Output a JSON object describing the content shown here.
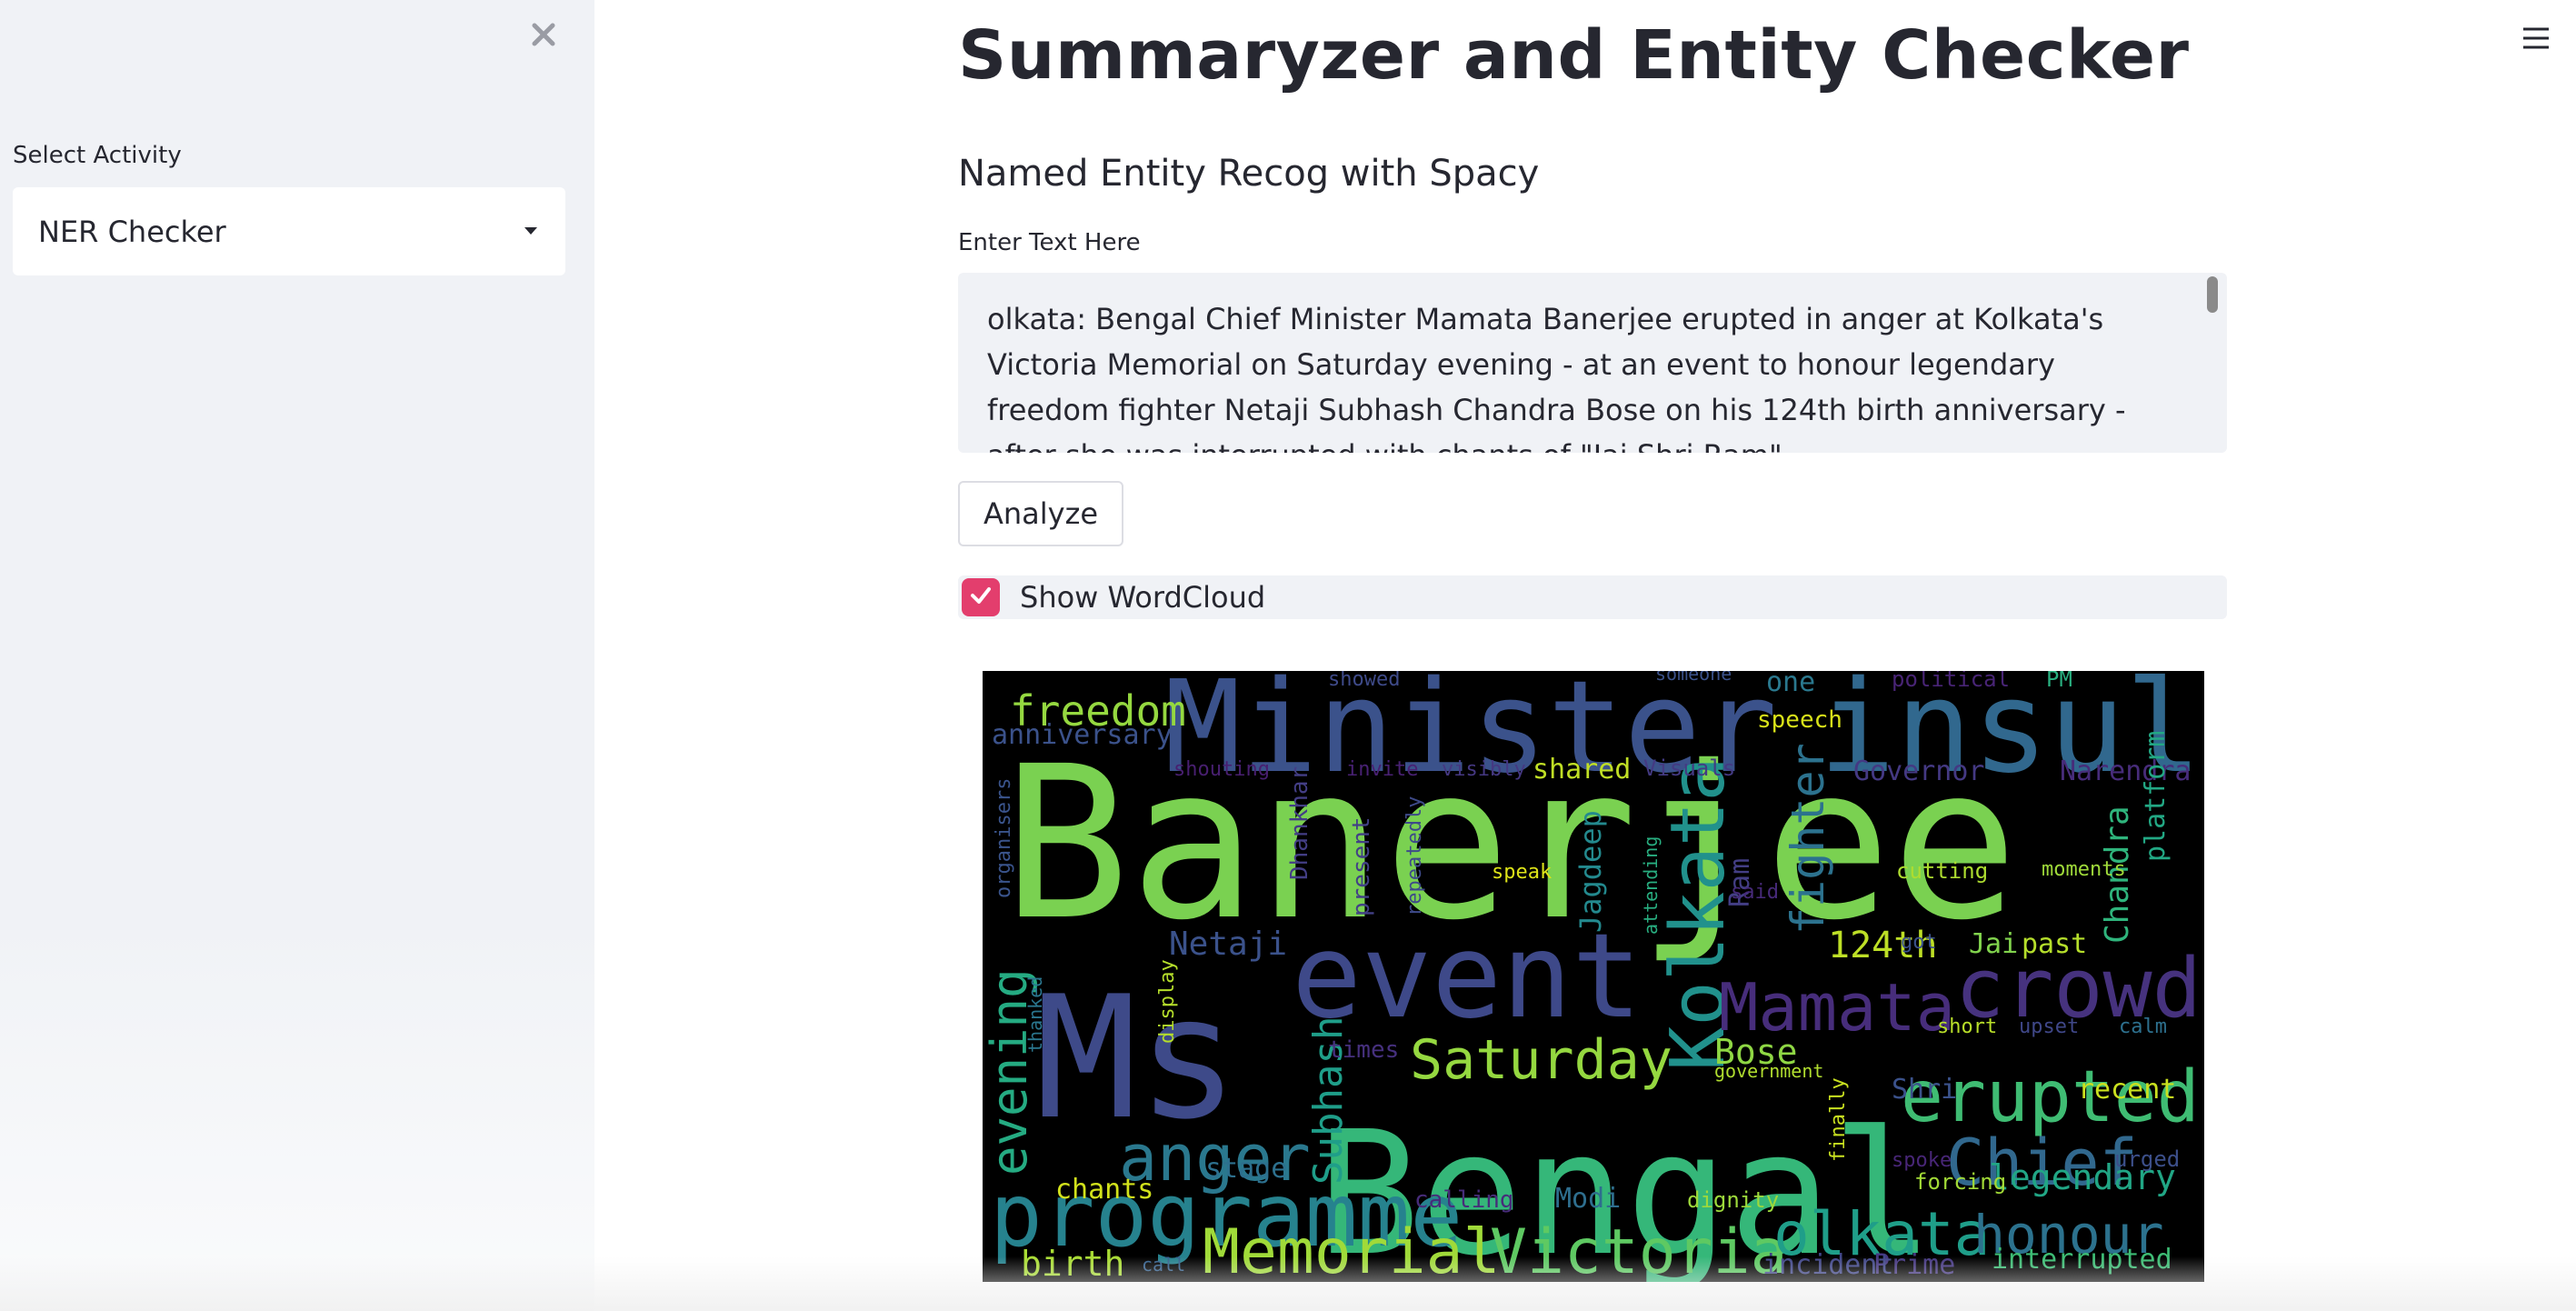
{
  "sidebar": {
    "label": "Select Activity",
    "select": {
      "value": "NER Checker"
    }
  },
  "main": {
    "title": "Summaryzer and Entity Checker",
    "subtitle": "Named Entity Recog with Spacy",
    "textarea": {
      "label": "Enter Text Here",
      "value": "olkata: Bengal Chief Minister Mamata Banerjee erupted in anger at Kolkata's Victoria Memorial on Saturday evening - at an event to honour legendary freedom fighter Netaji Subhash Chandra Bose on his 124th birth anniversary - after she was interrupted with chants of \"Jai Shri Ram\""
    },
    "analyze_button": "Analyze",
    "wordcloud_checkbox": {
      "label": "Show WordCloud",
      "checked": true
    }
  },
  "icons": [
    "close-icon",
    "chevron-down-icon",
    "hamburger-menu-icon",
    "check-icon"
  ],
  "colors": {
    "accent": "#e33e6d",
    "sidebar_bg": "#f0f2f6",
    "text": "#262730",
    "wordcloud_bg": "#000000"
  },
  "wordcloud": {
    "words": [
      {
        "text": "Banerjee",
        "color": "#7ad151"
      },
      {
        "text": "Bengal",
        "color": "#35b779"
      },
      {
        "text": "Ms",
        "color": "#3e4a89"
      },
      {
        "text": "Minister",
        "color": "#3b528b"
      },
      {
        "text": "insult",
        "color": "#31688e"
      },
      {
        "text": "event",
        "color": "#3e4989"
      },
      {
        "text": "crowd",
        "color": "#46327e"
      },
      {
        "text": "Kolkata",
        "color": "#21918c"
      },
      {
        "text": "programme",
        "color": "#26828e"
      },
      {
        "text": "Memorial",
        "color": "#a0da39"
      },
      {
        "text": "Victoria",
        "color": "#5ec962"
      },
      {
        "text": "erupted",
        "color": "#3fbc73"
      },
      {
        "text": "Chief",
        "color": "#31688e"
      },
      {
        "text": "Mamata",
        "color": "#472d7b"
      },
      {
        "text": "anger",
        "color": "#2a788e"
      },
      {
        "text": "Saturday",
        "color": "#95d840"
      },
      {
        "text": "olkata",
        "color": "#1f9e89"
      },
      {
        "text": "honour",
        "color": "#2c728e"
      },
      {
        "text": "freedom",
        "color": "#95d840"
      },
      {
        "text": "evening",
        "color": "#25ab82"
      },
      {
        "text": "Subhash",
        "color": "#1f9e89"
      },
      {
        "text": "fighter",
        "color": "#2c728e"
      },
      {
        "text": "legendary",
        "color": "#21a685"
      },
      {
        "text": "124th",
        "color": "#bddf26"
      },
      {
        "text": "Netaji",
        "color": "#3b528b"
      },
      {
        "text": "Jagdeep",
        "color": "#23898e"
      },
      {
        "text": "Bose",
        "color": "#8fd744"
      },
      {
        "text": "Chandra",
        "color": "#2fb47c"
      },
      {
        "text": "anniversary",
        "color": "#3b528b"
      },
      {
        "text": "birth",
        "color": "#a8db34"
      },
      {
        "text": "chants",
        "color": "#d2e21b"
      },
      {
        "text": "stage",
        "color": "#2d708e"
      },
      {
        "text": "recent",
        "color": "#cae11f"
      },
      {
        "text": "interrupted",
        "color": "#3dbc74"
      },
      {
        "text": "Governor",
        "color": "#443983"
      },
      {
        "text": "Narendra",
        "color": "#472c7a"
      },
      {
        "text": "platform",
        "color": "#22a884"
      },
      {
        "text": "Ram",
        "color": "#433e85"
      },
      {
        "text": "Shri",
        "color": "#3b528b"
      },
      {
        "text": "Jai",
        "color": "#81d34d"
      },
      {
        "text": "past",
        "color": "#b5de2b"
      },
      {
        "text": "Modi",
        "color": "#2e6e8e"
      },
      {
        "text": "Prime",
        "color": "#453781"
      },
      {
        "text": "incident",
        "color": "#404688"
      },
      {
        "text": "speech",
        "color": "#d8e219"
      },
      {
        "text": "one",
        "color": "#2a788e"
      },
      {
        "text": "political",
        "color": "#482475"
      },
      {
        "text": "PM",
        "color": "#29af7f"
      },
      {
        "text": "shared",
        "color": "#c0df25"
      },
      {
        "text": "Visuals",
        "color": "#443a83"
      },
      {
        "text": "shouting",
        "color": "#481f70"
      },
      {
        "text": "invite",
        "color": "#482173"
      },
      {
        "text": "visibly",
        "color": "#453882"
      },
      {
        "text": "Dhankhar",
        "color": "#433e85"
      },
      {
        "text": "present",
        "color": "#424086"
      },
      {
        "text": "repeatedly",
        "color": "#3e4a89"
      },
      {
        "text": "speak",
        "color": "#dde318"
      },
      {
        "text": "attending",
        "color": "#28ae80"
      },
      {
        "text": "said",
        "color": "#472a7a"
      },
      {
        "text": "cutting",
        "color": "#addc30"
      },
      {
        "text": "moments",
        "color": "#9fda3a"
      },
      {
        "text": "got",
        "color": "#3b528b"
      },
      {
        "text": "short",
        "color": "#b8de29"
      },
      {
        "text": "upset",
        "color": "#3f4788"
      },
      {
        "text": "calm",
        "color": "#2d708e"
      },
      {
        "text": "government",
        "color": "#b0dd2f"
      },
      {
        "text": "times",
        "color": "#46307e"
      },
      {
        "text": "finally",
        "color": "#c8e020"
      },
      {
        "text": "spoke",
        "color": "#482677"
      },
      {
        "text": "urged",
        "color": "#3c4f8a"
      },
      {
        "text": "forcing",
        "color": "#a2da37"
      },
      {
        "text": "dignity",
        "color": "#9dd93b"
      },
      {
        "text": "calling",
        "color": "#472c7a"
      },
      {
        "text": "call",
        "color": "#34608d"
      },
      {
        "text": "display",
        "color": "#b5de2b"
      },
      {
        "text": "thanked",
        "color": "#2a768e"
      },
      {
        "text": "organisers",
        "color": "#3a548c"
      },
      {
        "text": "showed",
        "color": "#3e4a89"
      },
      {
        "text": "someone",
        "color": "#3b528b"
      }
    ]
  }
}
